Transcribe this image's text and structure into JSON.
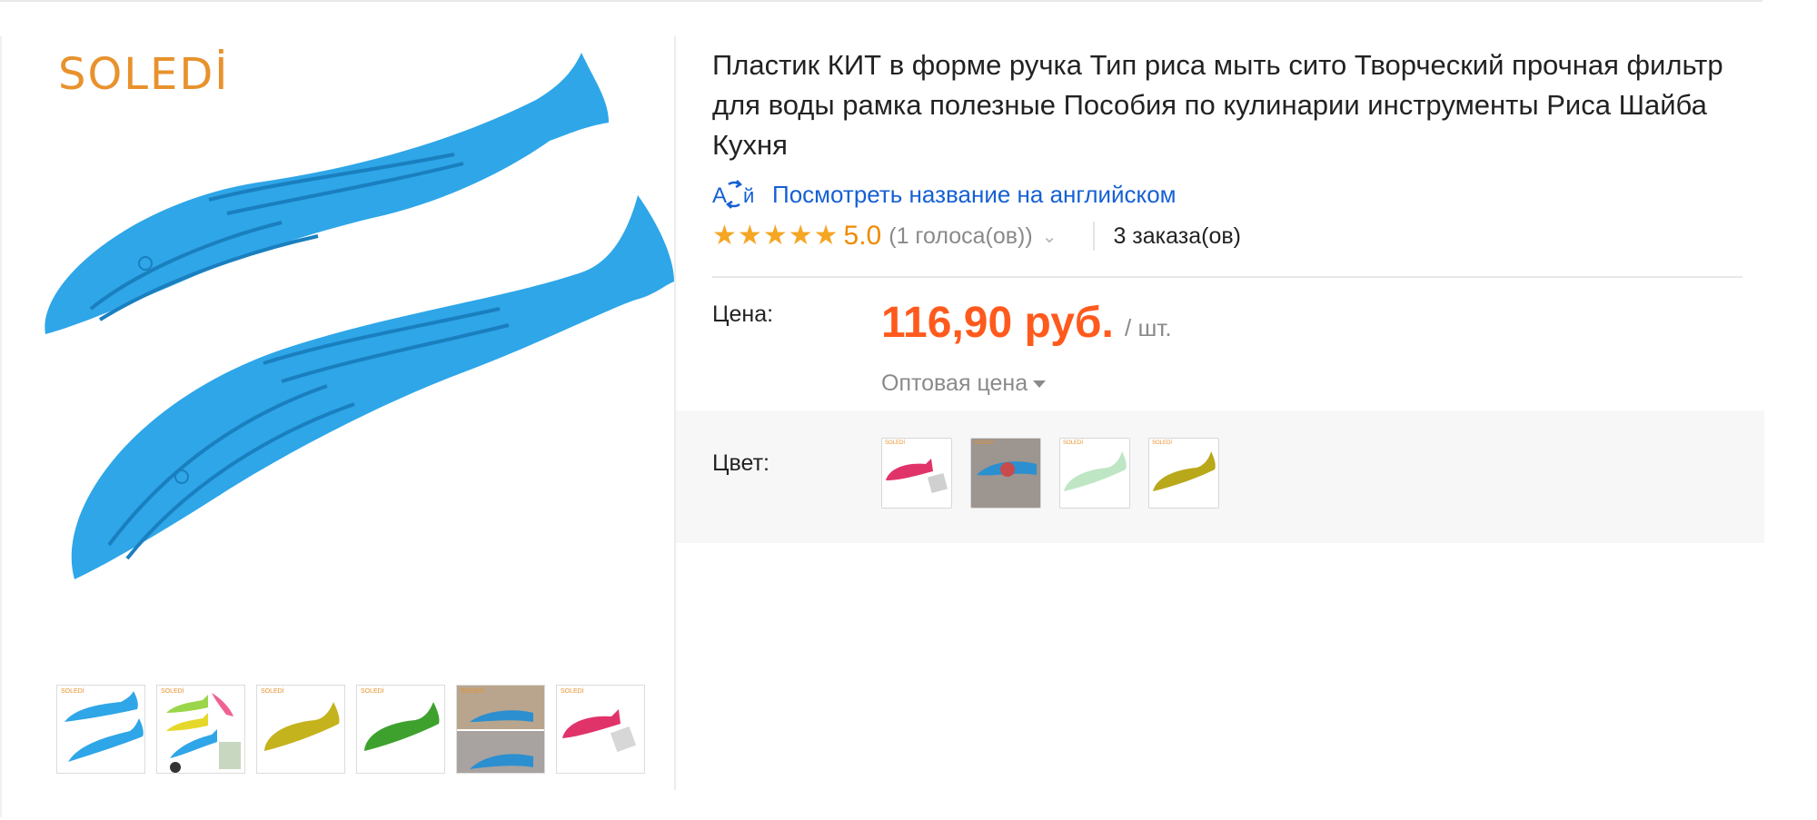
{
  "brand": "SOLEDİ",
  "gallery": {
    "thumbnails": [
      {
        "name": "thumb-blue-whales",
        "color": "#2ea6e8"
      },
      {
        "name": "thumb-color-collage",
        "color": "#9bd64a"
      },
      {
        "name": "thumb-yellow-whale",
        "color": "#c4b31c"
      },
      {
        "name": "thumb-green-whale",
        "color": "#3ea12e"
      },
      {
        "name": "thumb-in-use-photo",
        "color": "#2b8fd0"
      },
      {
        "name": "thumb-pink-whale",
        "color": "#e0336a"
      }
    ],
    "thumb_logo": "SOLEDİ"
  },
  "product": {
    "title": "Пластик КИТ в форме ручка Тип риса мыть сито Творческий прочная фильтр для воды рамка полезные Пособия по кулинарии инструменты Риса Шайба Кухня",
    "translate_link": "Посмотреть название на английском",
    "translate_icon_text": "A  й",
    "rating_value": "5.0",
    "stars": 5,
    "votes": "(1 голоса(ов))",
    "orders": "3 заказа(ов)"
  },
  "price": {
    "label": "Цена:",
    "value": "116,90 руб.",
    "per_unit": "/ шт.",
    "wholesale": "Оптовая цена"
  },
  "color": {
    "label": "Цвет:",
    "swatches": [
      {
        "name": "swatch-pink",
        "color": "#e0336a"
      },
      {
        "name": "swatch-photo",
        "color": "#2b8fd0"
      },
      {
        "name": "swatch-light-green",
        "color": "#bfe6c4"
      },
      {
        "name": "swatch-olive",
        "color": "#b9a81a"
      }
    ]
  },
  "colors": {
    "accent_price": "#ff5a1d",
    "link": "#1560d4",
    "star": "#f5a623",
    "whale_blue": "#2ea6e8",
    "brand": "#e8922d"
  }
}
